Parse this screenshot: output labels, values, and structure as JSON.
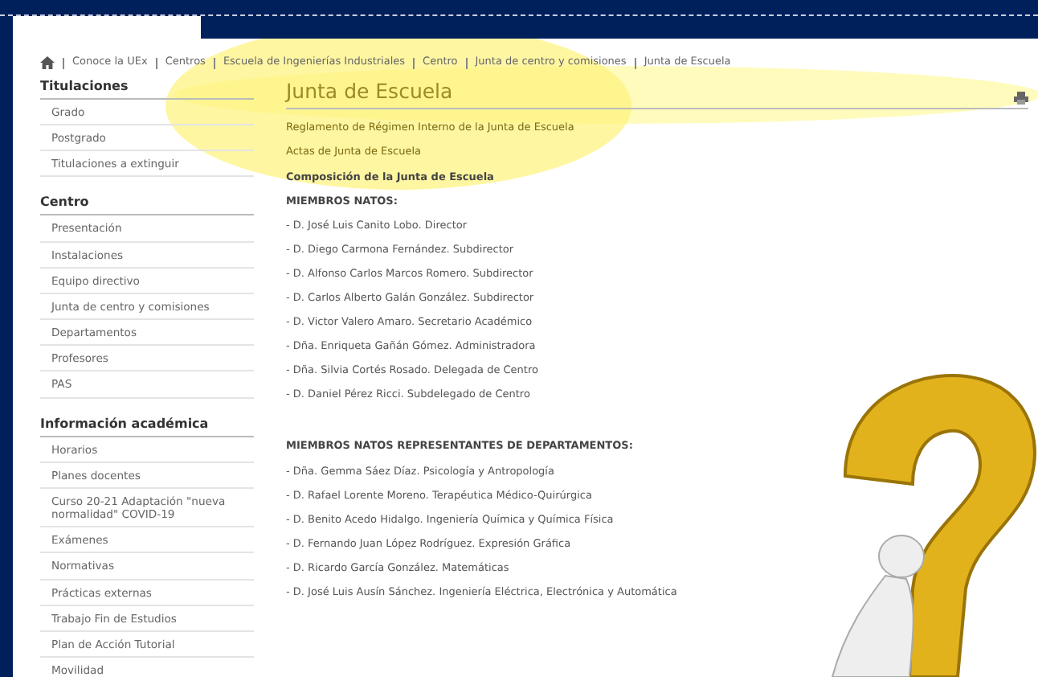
{
  "breadcrumb": [
    "Conoce la UEx",
    "Centros",
    "Escuela de Ingenierías Industriales",
    "Centro",
    "Junta de centro y comisiones",
    "Junta de Escuela"
  ],
  "sidebar": [
    {
      "title": "Titulaciones",
      "items": [
        "Grado",
        "Postgrado",
        "Titulaciones a extinguir"
      ]
    },
    {
      "title": "Centro",
      "items": [
        "Presentación",
        "Instalaciones",
        "Equipo directivo",
        "Junta de centro y comisiones",
        "Departamentos",
        "Profesores",
        "PAS"
      ]
    },
    {
      "title": "Información académica",
      "items": [
        "Horarios",
        "Planes docentes",
        "Curso 20-21 Adaptación \"nueva normalidad\" COVID-19",
        "Exámenes",
        "Normativas",
        "Prácticas externas",
        "Trabajo Fin de Estudios",
        "Plan de Acción Tutorial",
        "Movilidad"
      ]
    }
  ],
  "page_title": "Junta de Escuela",
  "links": [
    "Reglamento de Régimen Interno de la Junta de Escuela",
    "Actas de Junta de Escuela"
  ],
  "composition_heading": "Composición de la Junta de Escuela",
  "groups": [
    {
      "heading": "MIEMBROS NATOS:",
      "members": [
        "- D. José Luis Canito Lobo. Director",
        "- D. Diego Carmona Fernández. Subdirector",
        "- D. Alfonso Carlos Marcos Romero. Subdirector",
        "- D. Carlos Alberto Galán González. Subdirector",
        "- D. Victor Valero Amaro. Secretario Académico",
        "- Dña. Enriqueta Gañán Gómez. Administradora",
        "- Dña. Silvia Cortés Rosado. Delegada de Centro",
        "- D. Daniel Pérez Ricci. Subdelegado de Centro"
      ]
    },
    {
      "heading": "MIEMBROS NATOS REPRESENTANTES DE DEPARTAMENTOS:",
      "members": [
        "- Dña. Gemma Sáez Díaz. Psicología y Antropología",
        "- D. Rafael Lorente Moreno. Terapéutica Médico-Quirúrgica",
        "- D. Benito Acedo Hidalgo. Ingeniería Química y Química Física",
        "- D. Fernando Juan López Rodríguez. Expresión Gráfica",
        "- D. Ricardo García González. Matemáticas",
        "- D. José Luis Ausín Sánchez. Ingeniería Eléctrica, Electrónica y Automática"
      ]
    }
  ]
}
